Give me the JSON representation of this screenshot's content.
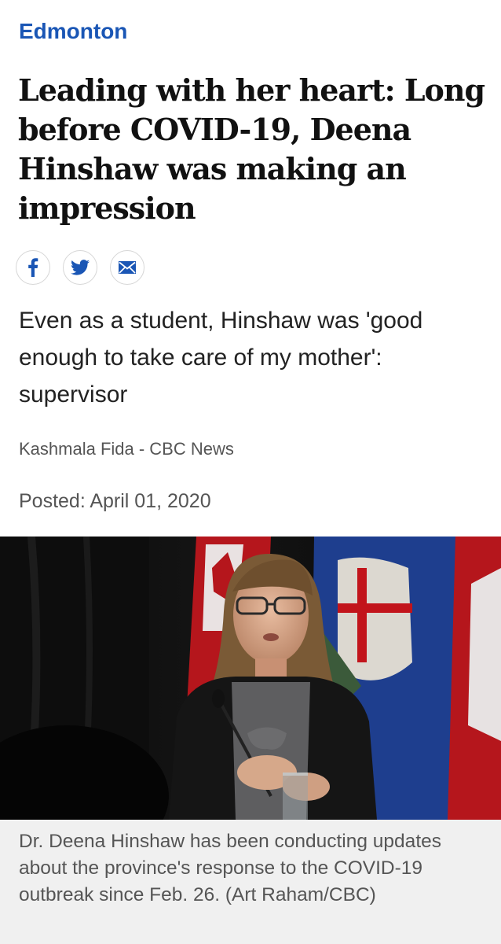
{
  "section": {
    "label": "Edmonton",
    "color": "#1a56b5"
  },
  "article": {
    "headline": "Leading with her heart: Long before COVID-19, Deena Hinshaw was making an impression",
    "deck": "Even as a student, Hinshaw was 'good enough to take care of my mother': supervisor",
    "byline": "Kashmala Fida - CBC News",
    "posted": "Posted: April 01, 2020"
  },
  "share": [
    {
      "icon": "facebook-icon",
      "color": "#1a56b5"
    },
    {
      "icon": "twitter-icon",
      "color": "#1a56b5"
    },
    {
      "icon": "email-icon",
      "color": "#1a56b5"
    }
  ],
  "photo": {
    "description_icon": "photo"
  },
  "caption": {
    "text": "Dr. Deena Hinshaw has been conducting updates about the province's response to the COVID-19 outbreak since Feb. 26. (Art Raham/CBC)"
  }
}
